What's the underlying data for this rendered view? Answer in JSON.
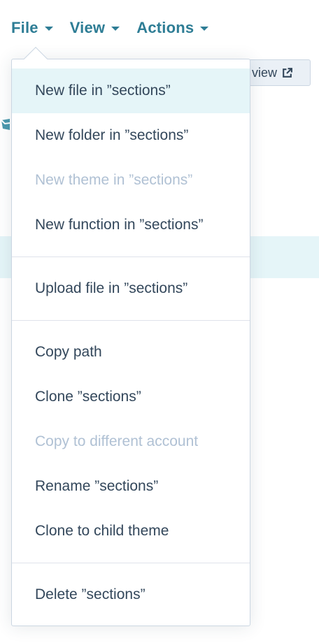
{
  "menubar": {
    "file": "File",
    "view": "View",
    "actions": "Actions"
  },
  "background": {
    "preview_label": "view"
  },
  "dropdown": {
    "group1": [
      {
        "label": "New file in ”sections”",
        "state": "hover"
      },
      {
        "label": "New folder in ”sections”",
        "state": "enabled"
      },
      {
        "label": "New theme in ”sections”",
        "state": "disabled"
      },
      {
        "label": "New function in ”sections”",
        "state": "enabled"
      }
    ],
    "group2": [
      {
        "label": "Upload file in ”sections”",
        "state": "enabled"
      }
    ],
    "group3": [
      {
        "label": "Copy path",
        "state": "enabled"
      },
      {
        "label": "Clone ”sections”",
        "state": "enabled"
      },
      {
        "label": "Copy to different account",
        "state": "disabled"
      },
      {
        "label": "Rename ”sections”",
        "state": "enabled"
      },
      {
        "label": "Clone to child theme",
        "state": "enabled"
      }
    ],
    "group4": [
      {
        "label": "Delete ”sections”",
        "state": "enabled"
      }
    ]
  },
  "colors": {
    "accent": "#2e7d95",
    "text": "#33475b",
    "disabled": "#b0c1d4",
    "hover_bg": "#e5f5f8",
    "border": "#cbd6e2"
  }
}
